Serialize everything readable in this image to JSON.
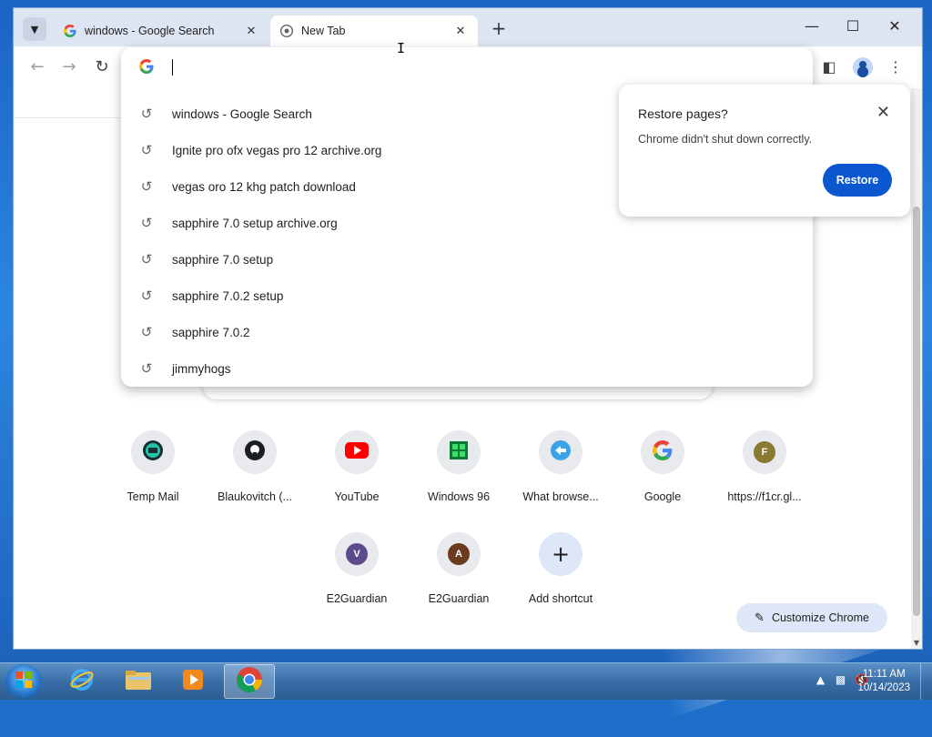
{
  "tabs": [
    {
      "title": "windows - Google Search",
      "favicon": "google-g-icon",
      "active": false
    },
    {
      "title": "New Tab",
      "favicon": "chrome-icon",
      "active": true
    }
  ],
  "omnibox": {
    "value": "",
    "suggestions": [
      "windows - Google Search",
      "Ignite pro ofx vegas pro 12 archive.org",
      "vegas oro 12 khg patch download",
      "sapphire 7.0 setup archive.org",
      "sapphire 7.0 setup",
      "sapphire 7.0.2 setup",
      "sapphire 7.0.2",
      "jimmyhogs"
    ]
  },
  "restore_bubble": {
    "title": "Restore pages?",
    "message": "Chrome didn't shut down correctly.",
    "button": "Restore"
  },
  "shortcuts_row1": [
    {
      "label": "Temp Mail",
      "icon": "temp-mail-icon"
    },
    {
      "label": "Blaukovitch (...",
      "icon": "github-icon"
    },
    {
      "label": "YouTube",
      "icon": "youtube-icon"
    },
    {
      "label": "Windows 96",
      "icon": "windows96-icon"
    },
    {
      "label": "What browse...",
      "icon": "browser-icon"
    },
    {
      "label": "Google",
      "icon": "google-g-icon"
    },
    {
      "label": "https://f1cr.gl...",
      "letter": "F",
      "color": "#8a7a32"
    }
  ],
  "shortcuts_row2": [
    {
      "label": "E2Guardian",
      "letter": "V",
      "color": "#5d4a8a"
    },
    {
      "label": "E2Guardian",
      "letter": "A",
      "color": "#6b3a1f"
    },
    {
      "label": "Add shortcut",
      "icon": "plus-icon"
    }
  ],
  "customize_label": "Customize Chrome",
  "taskbar": {
    "time": "11:11 AM",
    "date": "10/14/2023"
  },
  "colors": {
    "accent": "#0b57d0",
    "tabstrip": "#dee5f2"
  }
}
